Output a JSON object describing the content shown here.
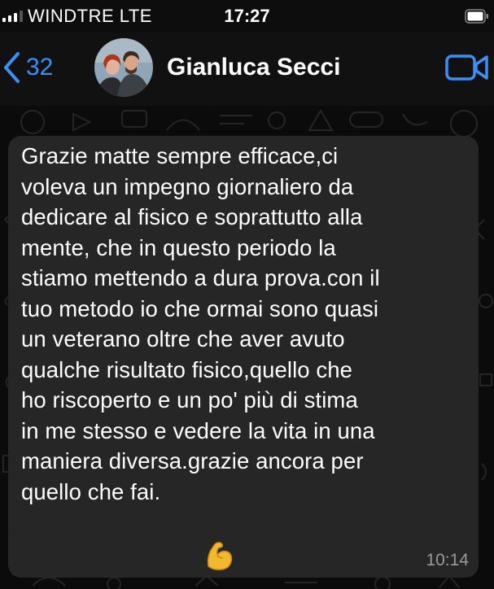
{
  "status_bar": {
    "carrier": "WINDTRE   LTE",
    "time": "17:27"
  },
  "header": {
    "back_count": "32",
    "contact_name": "Gianluca Secci"
  },
  "message": {
    "text": "Grazie matte sempre efficace,ci\nvoleva un impegno giornaliero da\ndedicare al fisico e soprattutto alla\nmente, che in questo periodo la\nstiamo mettendo a dura prova.con il\ntuo metodo io che ormai sono quasi\nun veterano oltre che aver avuto\nqualche risultato fisico,quello che\nho riscoperto e un po' più di stima\nin me stesso e vedere la vita in una\nmaniera diversa.grazie ancora per\nquello che fai.",
    "emoji": "flexed-biceps",
    "timestamp": "10:14"
  },
  "colors": {
    "accent": "#3b8ff5",
    "bubble": "#262626",
    "background": "#0b0b0b"
  }
}
